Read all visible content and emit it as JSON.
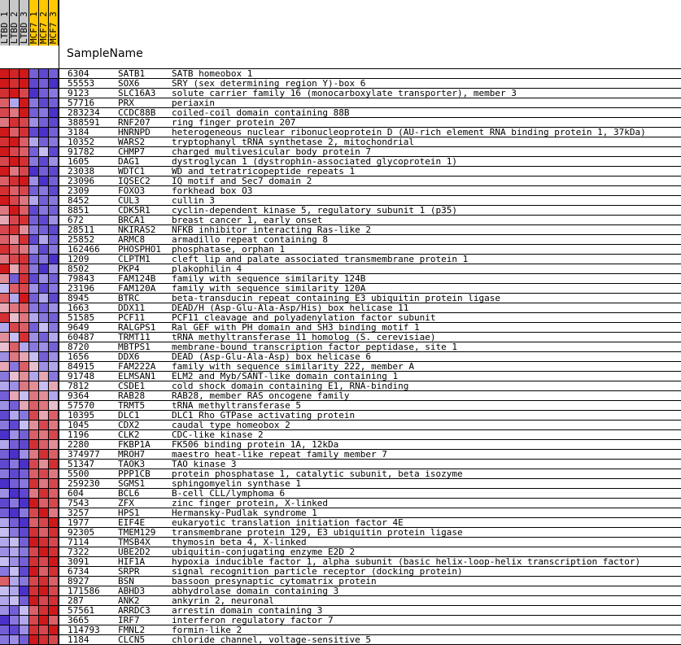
{
  "columns": [
    {
      "label": "LTBD_1",
      "group_color": "#c8c8c8"
    },
    {
      "label": "LTBD_2",
      "group_color": "#c8c8c8"
    },
    {
      "label": "LTBD_3",
      "group_color": "#c8c8c8"
    },
    {
      "label": "MCF7_1",
      "group_color": "#ffc800"
    },
    {
      "label": "MCF7_2",
      "group_color": "#ffc800"
    },
    {
      "label": "MCF7_3",
      "group_color": "#ffc800"
    }
  ],
  "sample_header": "SampleName",
  "colors": {
    "high": "#cc0000",
    "mid": "#eeeeff",
    "low": "#2200bb"
  },
  "chart_data": {
    "type": "heatmap",
    "columns": [
      "LTBD_1",
      "LTBD_2",
      "LTBD_3",
      "MCF7_1",
      "MCF7_2",
      "MCF7_3"
    ],
    "rows": [
      {
        "id": "6304",
        "symbol": "SATB1",
        "description": "SATB homeobox 1",
        "values": [
          0.9,
          0.85,
          0.9,
          -0.6,
          -0.7,
          -0.6
        ]
      },
      {
        "id": "55553",
        "symbol": "SOX6",
        "description": "SRY (sex determining region Y)-box 6",
        "values": [
          0.9,
          0.8,
          0.9,
          -0.7,
          -0.6,
          -0.8
        ]
      },
      {
        "id": "9123",
        "symbol": "SLC16A3",
        "description": "solute carrier family 16 (monocarboxylate transporter), member 3",
        "values": [
          0.8,
          0.9,
          0.7,
          -0.8,
          -0.6,
          -0.5
        ]
      },
      {
        "id": "57716",
        "symbol": "PRX",
        "description": "periaxin",
        "values": [
          0.6,
          -0.3,
          0.9,
          -0.5,
          -0.7,
          -0.6
        ]
      },
      {
        "id": "283234",
        "symbol": "CCDC88B",
        "description": "coiled-coil domain containing 88B",
        "values": [
          0.7,
          0.5,
          0.9,
          -0.6,
          -0.5,
          -0.8
        ]
      },
      {
        "id": "388591",
        "symbol": "RNF207",
        "description": "ring finger protein 207",
        "values": [
          0.5,
          0.8,
          0.7,
          -0.4,
          -0.6,
          -0.7
        ]
      },
      {
        "id": "3184",
        "symbol": "HNRNPD",
        "description": "heterogeneous nuclear ribonucleoprotein D (AU-rich element RNA binding protein 1, 37kDa)",
        "values": [
          0.9,
          0.6,
          0.8,
          -0.7,
          -0.8,
          -0.6
        ]
      },
      {
        "id": "10352",
        "symbol": "WARS2",
        "description": "tryptophanyl tRNA synthetase 2, mitochondrial",
        "values": [
          0.8,
          0.9,
          0.6,
          -0.3,
          -0.6,
          -0.5
        ]
      },
      {
        "id": "91782",
        "symbol": "CHMP7",
        "description": "charged multivesicular body protein 7",
        "values": [
          0.9,
          0.7,
          0.6,
          -0.6,
          -0.2,
          -0.7
        ]
      },
      {
        "id": "1605",
        "symbol": "DAG1",
        "description": "dystroglycan 1 (dystrophin-associated glycoprotein 1)",
        "values": [
          0.7,
          0.9,
          0.8,
          -0.5,
          -0.7,
          -0.4
        ]
      },
      {
        "id": "23038",
        "symbol": "WDTC1",
        "description": "WD and tetratricopeptide repeats 1",
        "values": [
          0.9,
          0.5,
          0.7,
          -0.8,
          -0.6,
          -0.7
        ]
      },
      {
        "id": "23096",
        "symbol": "IQSEC2",
        "description": "IQ motif and Sec7 domain 2",
        "values": [
          0.6,
          0.8,
          0.9,
          -0.4,
          -0.8,
          -0.6
        ]
      },
      {
        "id": "2309",
        "symbol": "FOXO3",
        "description": "forkhead box O3",
        "values": [
          0.8,
          0.6,
          0.7,
          -0.6,
          -0.5,
          -0.7
        ]
      },
      {
        "id": "8452",
        "symbol": "CUL3",
        "description": "cullin 3",
        "values": [
          0.9,
          0.7,
          0.5,
          -0.3,
          -0.6,
          -0.5
        ]
      },
      {
        "id": "8851",
        "symbol": "CDK5R1",
        "description": "cyclin-dependent kinase 5, regulatory subunit 1 (p35)",
        "values": [
          0.5,
          0.9,
          0.6,
          -0.7,
          -0.5,
          -0.6
        ]
      },
      {
        "id": "672",
        "symbol": "BRCA1",
        "description": "breast cancer 1, early onset",
        "values": [
          0.3,
          0.7,
          0.8,
          -0.6,
          -0.7,
          -0.4
        ]
      },
      {
        "id": "28511",
        "symbol": "NKIRAS2",
        "description": "NFKB inhibitor interacting Ras-like 2",
        "values": [
          0.7,
          0.8,
          0.4,
          -0.5,
          -0.6,
          -0.7
        ]
      },
      {
        "id": "25852",
        "symbol": "ARMC8",
        "description": "armadillo repeat containing 8",
        "values": [
          0.6,
          0.4,
          0.8,
          -0.7,
          -0.3,
          -0.6
        ]
      },
      {
        "id": "162466",
        "symbol": "PHOSPHO1",
        "description": "phosphatase, orphan 1",
        "values": [
          0.8,
          0.6,
          0.5,
          -0.4,
          -0.7,
          -0.5
        ]
      },
      {
        "id": "1209",
        "symbol": "CLPTM1",
        "description": "cleft lip and palate associated transmembrane protein 1",
        "values": [
          0.5,
          0.7,
          0.8,
          -0.6,
          -0.5,
          -0.8
        ]
      },
      {
        "id": "8502",
        "symbol": "PKP4",
        "description": "plakophilin 4",
        "values": [
          0.9,
          0.3,
          0.7,
          -0.5,
          -0.8,
          -0.4
        ]
      },
      {
        "id": "79843",
        "symbol": "FAM124B",
        "description": "family with sequence similarity 124B",
        "values": [
          0.4,
          -0.6,
          0.8,
          -0.7,
          -0.4,
          -0.6
        ]
      },
      {
        "id": "23196",
        "symbol": "FAM120A",
        "description": "family with sequence similarity 120A",
        "values": [
          -0.2,
          0.6,
          0.7,
          -0.4,
          -0.7,
          -0.5
        ]
      },
      {
        "id": "8945",
        "symbol": "BTRC",
        "description": "beta-transducin repeat containing E3 ubiquitin protein ligase",
        "values": [
          0.6,
          -0.3,
          0.9,
          -0.6,
          -0.3,
          -0.7
        ]
      },
      {
        "id": "1663",
        "symbol": "DDX11",
        "description": "DEAD/H (Asp-Glu-Ala-Asp/His) box helicase 11",
        "values": [
          0.3,
          0.5,
          0.6,
          -0.5,
          -0.6,
          -0.4
        ]
      },
      {
        "id": "51585",
        "symbol": "PCF11",
        "description": "PCF11 cleavage and polyadenylation factor subunit",
        "values": [
          0.8,
          0.2,
          0.5,
          -0.3,
          -0.5,
          -0.6
        ]
      },
      {
        "id": "9649",
        "symbol": "RALGPS1",
        "description": "Ral GEF with PH domain and SH3 binding motif 1",
        "values": [
          -0.3,
          0.7,
          0.6,
          -0.6,
          -0.2,
          -0.5
        ]
      },
      {
        "id": "60487",
        "symbol": "TRMT11",
        "description": "tRNA methyltransferase 11 homolog (S. cerevisiae)",
        "values": [
          0.4,
          -0.2,
          0.8,
          -0.4,
          -0.6,
          -0.3
        ]
      },
      {
        "id": "8720",
        "symbol": "MBTPS1",
        "description": "membrane-bound transcription factor peptidase, site 1",
        "values": [
          0.2,
          0.6,
          -0.3,
          -0.5,
          -0.4,
          -0.6
        ]
      },
      {
        "id": "1656",
        "symbol": "DDX6",
        "description": "DEAD (Asp-Glu-Ala-Asp) box helicase 6",
        "values": [
          -0.4,
          0.5,
          0.3,
          -0.2,
          -0.6,
          -0.4
        ]
      },
      {
        "id": "84915",
        "symbol": "FAM222A",
        "description": "family with sequence similarity 222, member A",
        "values": [
          0.3,
          -0.5,
          0.6,
          0.2,
          -0.4,
          -0.3
        ]
      },
      {
        "id": "91748",
        "symbol": "ELMSAN1",
        "description": "ELM2 and Myb/SANT-like domain containing 1",
        "values": [
          -0.5,
          0.2,
          0.4,
          -0.3,
          0.3,
          -0.5
        ]
      },
      {
        "id": "7812",
        "symbol": "CSDE1",
        "description": "cold shock domain containing E1, RNA-binding",
        "values": [
          -0.3,
          -0.4,
          0.5,
          0.4,
          -0.2,
          0.3
        ]
      },
      {
        "id": "9364",
        "symbol": "RAB28",
        "description": "RAB28, member RAS oncogene family",
        "values": [
          -0.6,
          0.3,
          -0.2,
          0.5,
          0.4,
          -0.3
        ]
      },
      {
        "id": "57570",
        "symbol": "TRMT5",
        "description": "tRNA methyltransferase 5",
        "values": [
          -0.4,
          -0.6,
          0.3,
          0.6,
          0.5,
          0.2
        ]
      },
      {
        "id": "10395",
        "symbol": "DLC1",
        "description": "DLC1 Rho GTPase activating protein",
        "values": [
          -0.7,
          -0.3,
          -0.5,
          0.7,
          0.3,
          0.6
        ]
      },
      {
        "id": "1045",
        "symbol": "CDX2",
        "description": "caudal type homeobox 2",
        "values": [
          -0.5,
          -0.7,
          -0.2,
          0.4,
          0.7,
          0.5
        ]
      },
      {
        "id": "1196",
        "symbol": "CLK2",
        "description": "CDC-like kinase 2",
        "values": [
          -0.8,
          -0.4,
          -0.6,
          0.6,
          0.5,
          0.7
        ]
      },
      {
        "id": "2280",
        "symbol": "FKBP1A",
        "description": "FK506 binding protein 1A, 12kDa",
        "values": [
          -0.3,
          -0.6,
          -0.7,
          0.8,
          0.6,
          0.4
        ]
      },
      {
        "id": "374977",
        "symbol": "MROH7",
        "description": "maestro heat-like repeat family member 7",
        "values": [
          -0.6,
          -0.8,
          -0.4,
          0.5,
          0.8,
          0.6
        ]
      },
      {
        "id": "51347",
        "symbol": "TAOK3",
        "description": "TAO kinase 3",
        "values": [
          -0.7,
          -0.5,
          -0.8,
          0.7,
          0.4,
          0.8
        ]
      },
      {
        "id": "5500",
        "symbol": "PPP1CB",
        "description": "protein phosphatase 1, catalytic subunit, beta isozyme",
        "values": [
          -0.5,
          -0.7,
          -0.6,
          0.6,
          0.7,
          0.5
        ]
      },
      {
        "id": "259230",
        "symbol": "SGMS1",
        "description": "sphingomyelin synthase 1",
        "values": [
          -0.8,
          -0.6,
          -0.5,
          0.8,
          0.5,
          0.7
        ]
      },
      {
        "id": "604",
        "symbol": "BCL6",
        "description": "B-cell CLL/lymphoma 6",
        "values": [
          -0.4,
          -0.8,
          -0.7,
          0.5,
          0.8,
          0.6
        ]
      },
      {
        "id": "7543",
        "symbol": "ZFX",
        "description": "zinc finger protein, X-linked",
        "values": [
          -0.7,
          -0.5,
          -0.8,
          0.9,
          0.6,
          0.7
        ]
      },
      {
        "id": "3257",
        "symbol": "HPS1",
        "description": "Hermansky-Pudlak syndrome 1",
        "values": [
          -0.6,
          -0.8,
          -0.5,
          0.7,
          0.9,
          0.5
        ]
      },
      {
        "id": "1977",
        "symbol": "EIF4E",
        "description": "eukaryotic translation initiation factor 4E",
        "values": [
          -0.3,
          -0.6,
          -0.8,
          0.6,
          0.7,
          0.9
        ]
      },
      {
        "id": "92305",
        "symbol": "TMEM129",
        "description": "transmembrane protein 129, E3 ubiquitin protein ligase",
        "values": [
          -0.2,
          -0.5,
          -0.7,
          0.8,
          0.6,
          0.8
        ]
      },
      {
        "id": "7114",
        "symbol": "TMSB4X",
        "description": "thymosin beta 4, X-linked",
        "values": [
          -0.3,
          -0.2,
          -0.6,
          0.9,
          0.8,
          0.7
        ]
      },
      {
        "id": "7322",
        "symbol": "UBE2D2",
        "description": "ubiquitin-conjugating enzyme E2D 2",
        "values": [
          -0.4,
          -0.3,
          -0.5,
          0.7,
          0.9,
          0.8
        ]
      },
      {
        "id": "3091",
        "symbol": "HIF1A",
        "description": "hypoxia inducible factor 1, alpha subunit (basic helix-loop-helix transcription factor)",
        "values": [
          -0.2,
          -0.4,
          -0.6,
          0.8,
          0.7,
          0.9
        ]
      },
      {
        "id": "6734",
        "symbol": "SRPR",
        "description": "signal recognition particle receptor (docking protein)",
        "values": [
          -0.5,
          -0.2,
          -0.7,
          0.9,
          0.6,
          0.8
        ]
      },
      {
        "id": "8927",
        "symbol": "BSN",
        "description": "bassoon presynaptic cytomatrix protein",
        "values": [
          0.6,
          -0.3,
          -0.5,
          0.7,
          0.8,
          0.6
        ]
      },
      {
        "id": "171586",
        "symbol": "ABHD3",
        "description": "abhydrolase domain containing 3",
        "values": [
          -0.2,
          -0.3,
          -0.8,
          0.8,
          0.9,
          0.7
        ]
      },
      {
        "id": "287",
        "symbol": "ANK2",
        "description": "ankyrin 2, neuronal",
        "values": [
          -0.3,
          -0.2,
          -0.6,
          0.9,
          0.7,
          0.8
        ]
      },
      {
        "id": "57561",
        "symbol": "ARRDC3",
        "description": "arrestin domain containing 3",
        "values": [
          -0.4,
          -0.6,
          -0.2,
          0.6,
          0.8,
          0.9
        ]
      },
      {
        "id": "3665",
        "symbol": "IRF7",
        "description": "interferon regulatory factor 7",
        "values": [
          -0.8,
          -0.5,
          -0.3,
          0.7,
          0.9,
          0.6
        ]
      },
      {
        "id": "114793",
        "symbol": "FMNL2",
        "description": "formin-like 2",
        "values": [
          -0.6,
          -0.7,
          -0.4,
          0.8,
          0.7,
          0.9
        ]
      },
      {
        "id": "1184",
        "symbol": "CLCN5",
        "description": "chloride channel, voltage-sensitive 5",
        "values": [
          -0.5,
          -0.4,
          -0.6,
          0.9,
          0.8,
          0.7
        ]
      }
    ]
  }
}
